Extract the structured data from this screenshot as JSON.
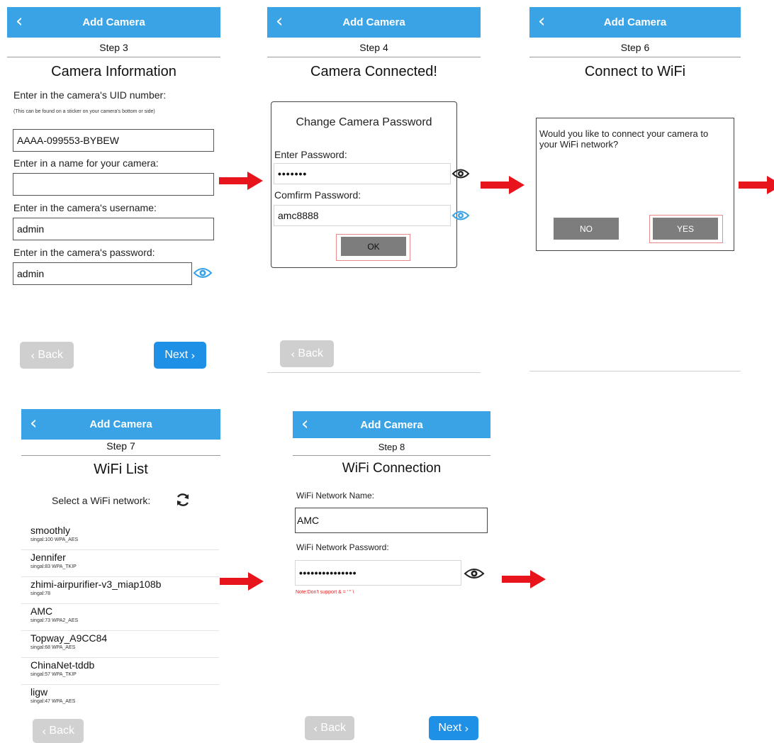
{
  "screen1": {
    "nav_title": "Add Camera",
    "step": "Step 3",
    "heading": "Camera Information",
    "uid_label": "Enter in the camera's UID number:",
    "uid_hint": "(This can be found on a sticker on your camera's bottom or side)",
    "uid_value": "AAAA-099553-BYBEW",
    "name_label": "Enter in a name for your camera:",
    "name_value": "",
    "username_label": "Enter in the camera's username:",
    "username_value": "admin",
    "password_label": "Enter in the camera's password:",
    "password_value": "admin",
    "back_label": "Back",
    "next_label": "Next"
  },
  "screen2": {
    "nav_title": "Add Camera",
    "step": "Step 4",
    "heading": "Camera Connected!",
    "dialog_title": "Change Camera Password",
    "enter_label": "Enter Password:",
    "enter_value": "•••••••",
    "confirm_label": "Comfirm Password:",
    "confirm_value": "amc8888",
    "ok_label": "OK",
    "back_label": "Back"
  },
  "screen3": {
    "nav_title": "Add Camera",
    "step": "Step 6",
    "heading": "Connect to WiFi",
    "dialog_text": "Would you like to connect your camera to your WiFi network?",
    "no_label": "NO",
    "yes_label": "YES"
  },
  "screen4": {
    "nav_title": "Add Camera",
    "step": "Step 7",
    "heading": "WiFi List",
    "select_label": "Select a WiFi network:",
    "networks": [
      {
        "name": "smoothly",
        "meta": "singal:100   WPA_AES"
      },
      {
        "name": "Jennifer",
        "meta": "singal:83   WPA_TKIP"
      },
      {
        "name": "zhimi-airpurifier-v3_miap108b",
        "meta": "singal:78"
      },
      {
        "name": "AMC",
        "meta": "singal:73   WPA2_AES"
      },
      {
        "name": "Topway_A9CC84",
        "meta": "singal:68   WPA_AES"
      },
      {
        "name": "ChinaNet-tddb",
        "meta": "singal:57   WPA_TKIP"
      },
      {
        "name": "ligw",
        "meta": "singal:47   WPA_AES"
      }
    ],
    "back_label": "Back"
  },
  "screen5": {
    "nav_title": "Add Camera",
    "step": "Step 8",
    "heading": "WiFi Connection",
    "name_label": "WiFi Network Name:",
    "name_value": "AMC",
    "password_label": "WiFi Network Password:",
    "password_value": "•••••••••••••••",
    "note": "Note:Don't support & = ' \" \\",
    "back_label": "Back",
    "next_label": "Next"
  },
  "colors": {
    "navbar": "#3aa3e6",
    "next_button": "#1e90e6",
    "arrow": "#e8141c",
    "highlight_box": "#e88a8a"
  },
  "icons": [
    "back-chevron-icon",
    "eye-icon",
    "refresh-icon",
    "chevron-right-icon",
    "chevron-left-icon",
    "right-arrow-icon"
  ]
}
